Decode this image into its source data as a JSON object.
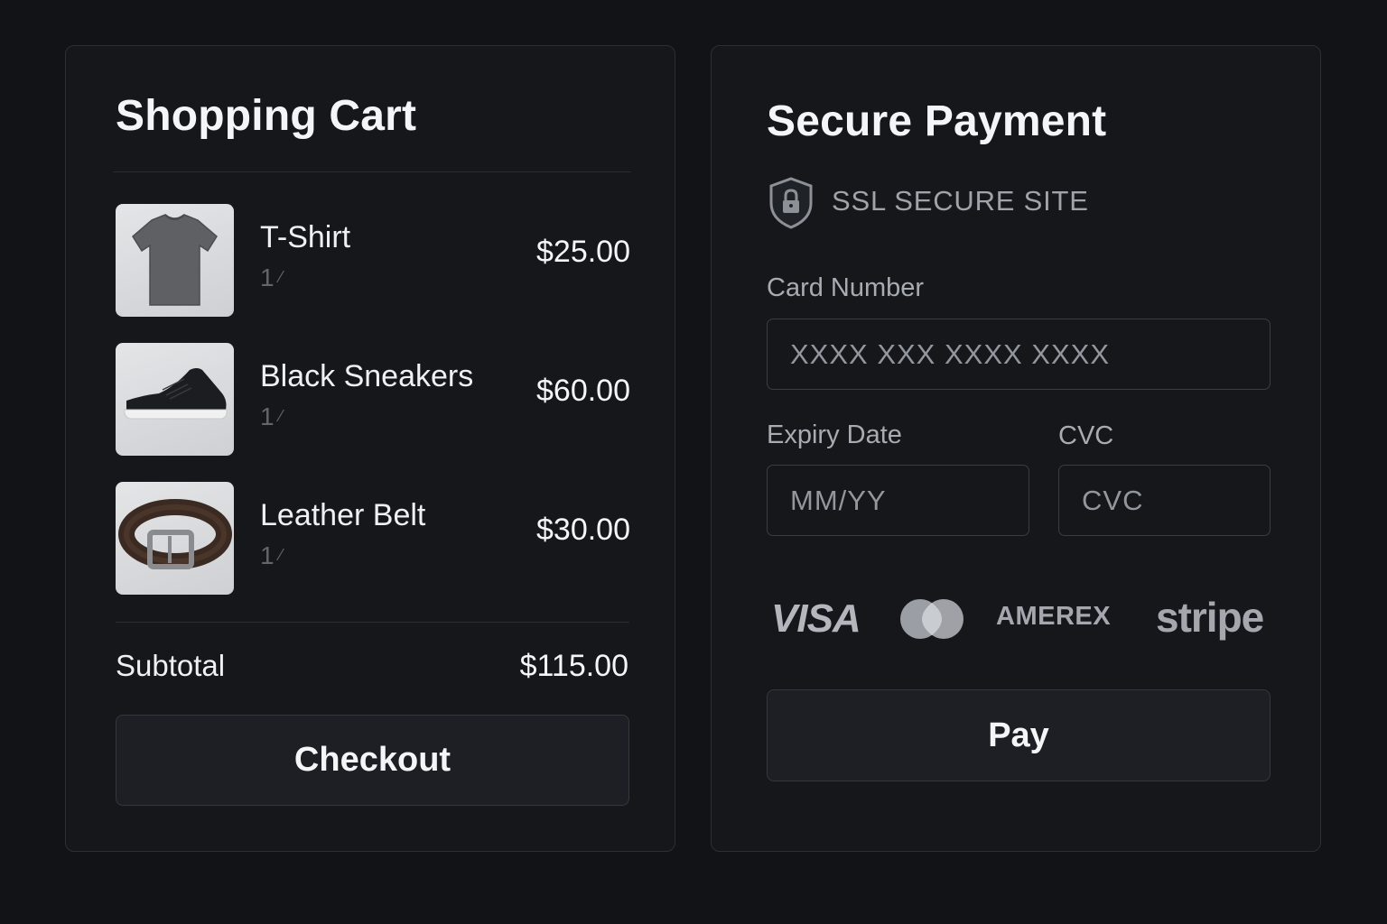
{
  "cart": {
    "title": "Shopping Cart",
    "items": [
      {
        "name": "T-Shirt",
        "qty": "1",
        "price": "$25.00",
        "image": "t-shirt-image"
      },
      {
        "name": "Black Sneakers",
        "qty": "1",
        "price": "$60.00",
        "image": "sneakers-image"
      },
      {
        "name": "Leather Belt",
        "qty": "1",
        "price": "$30.00",
        "image": "belt-image"
      }
    ],
    "subtotal_label": "Subtotal",
    "subtotal_value": "$115.00",
    "checkout_label": "Checkout"
  },
  "payment": {
    "title": "Secure Payment",
    "ssl_text": "SSL SECURE SITE",
    "card_number_label": "Card Number",
    "card_number_placeholder": "XXXX XXX XXXX XXXX",
    "expiry_label": "Expiry Date",
    "expiry_placeholder": "MM/YY",
    "cvc_label": "CVC",
    "cvc_placeholder": "CVC",
    "brands": {
      "visa": "VISA",
      "mastercard": "mastercard-logo",
      "amex": "AMEREX",
      "stripe": "stripe"
    },
    "pay_label": "Pay"
  },
  "colors": {
    "background": "#111317",
    "panel": "#15171b",
    "border": "#2c2f35",
    "text_primary": "#f4f5f7",
    "text_muted": "#61656c"
  }
}
